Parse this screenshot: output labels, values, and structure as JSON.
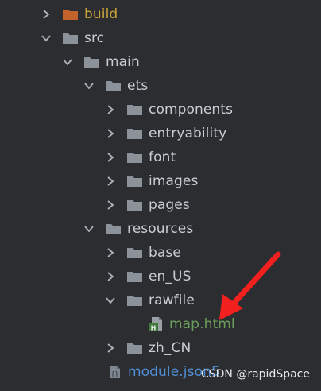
{
  "project_tree": {
    "items": [
      {
        "label": "build",
        "expanded": false,
        "icon": "folder-icon",
        "color": "#c9a23a"
      },
      {
        "label": "src",
        "expanded": true,
        "icon": "folder-icon"
      },
      {
        "label": "main",
        "expanded": true,
        "icon": "folder-icon"
      },
      {
        "label": "ets",
        "expanded": true,
        "icon": "folder-icon"
      },
      {
        "label": "components",
        "expanded": false,
        "icon": "folder-icon"
      },
      {
        "label": "entryability",
        "expanded": false,
        "icon": "folder-icon"
      },
      {
        "label": "font",
        "expanded": false,
        "icon": "folder-icon"
      },
      {
        "label": "images",
        "expanded": false,
        "icon": "folder-icon"
      },
      {
        "label": "pages",
        "expanded": false,
        "icon": "folder-icon"
      },
      {
        "label": "resources",
        "expanded": true,
        "icon": "folder-icon"
      },
      {
        "label": "base",
        "expanded": false,
        "icon": "folder-icon"
      },
      {
        "label": "en_US",
        "expanded": false,
        "icon": "folder-icon"
      },
      {
        "label": "rawfile",
        "expanded": true,
        "icon": "folder-icon"
      },
      {
        "label": "map.html",
        "icon": "html-file-icon",
        "color": "#6a9f5a"
      },
      {
        "label": "zh_CN",
        "expanded": false,
        "icon": "folder-icon"
      },
      {
        "label": "module.json5",
        "icon": "json-file-icon",
        "color": "#4f8fd6"
      }
    ]
  },
  "annotation": {
    "arrow_color": "#f2201e"
  },
  "watermark": "CSDN @rapidSpace",
  "colors": {
    "background": "#2b2d30",
    "folder": "#8c929a",
    "build_folder": "#c4622c",
    "text": "#c9cdd3"
  }
}
